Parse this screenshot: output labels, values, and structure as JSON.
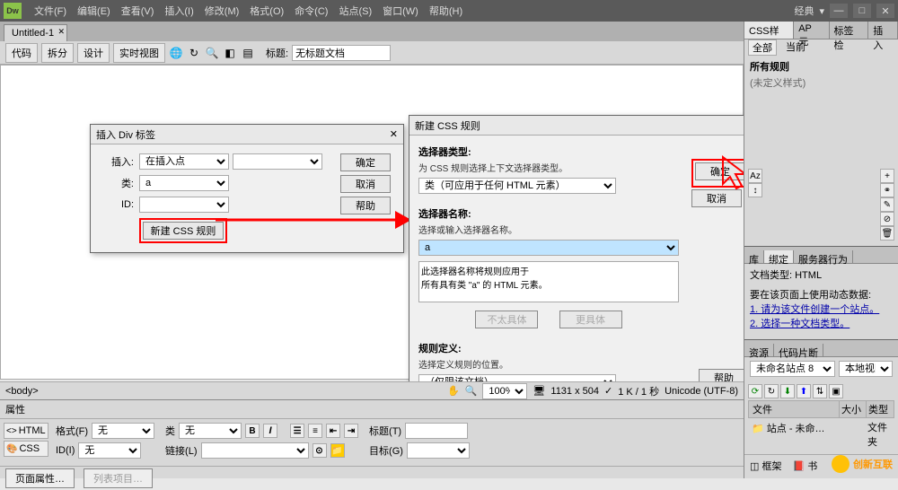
{
  "menubar": {
    "items": [
      "文件(F)",
      "编辑(E)",
      "查看(V)",
      "插入(I)",
      "修改(M)",
      "格式(O)",
      "命令(C)",
      "站点(S)",
      "窗口(W)",
      "帮助(H)"
    ],
    "layout_label": "经典"
  },
  "document": {
    "tab_label": "Untitled-1"
  },
  "toolbar": {
    "views": [
      "代码",
      "拆分",
      "设计",
      "实时视图"
    ],
    "title_label": "标题:",
    "title_value": "无标题文档"
  },
  "dialog_div": {
    "title": "插入 Div 标签",
    "insert_label": "插入:",
    "insert_value": "在插入点",
    "class_label": "类:",
    "class_value": "a",
    "id_label": "ID:",
    "id_value": "",
    "new_rule_btn": "新建 CSS 规则",
    "ok": "确定",
    "cancel": "取消",
    "help": "帮助"
  },
  "dialog_css": {
    "title": "新建 CSS 规则",
    "selector_type_label": "选择器类型:",
    "selector_type_desc": "为 CSS 规则选择上下文选择器类型。",
    "selector_type_value": "类（可应用于任何 HTML 元素）",
    "selector_name_label": "选择器名称:",
    "selector_name_desc": "选择或输入选择器名称。",
    "selector_name_value": "a",
    "preview_text": "此选择器名称将规则应用于\n所有具有类 \"a\" 的 HTML 元素。",
    "less_specific": "不太具体",
    "more_specific": "更具体",
    "rule_def_label": "规则定义:",
    "rule_def_desc": "选择定义规则的位置。",
    "rule_def_value": "（仅限该文档）",
    "ok": "确定",
    "cancel": "取消",
    "help": "帮助"
  },
  "right_panel": {
    "tabs": [
      "CSS样式",
      "AP 元",
      "标签检",
      "插入"
    ],
    "subtabs": [
      "全部",
      "当前"
    ],
    "all_rules_title": "所有规则",
    "no_style": "(未定义样式)",
    "mid_tabs": [
      "库",
      "绑定",
      "服务器行为"
    ],
    "doc_type_label": "文档类型: HTML",
    "dynamic_hint": "要在该页面上使用动态数据:",
    "step1": "1. 请为该文件创建一个站点。",
    "step2": "2. 选择一种文档类型。",
    "res_tabs": [
      "资源",
      "代码片断"
    ],
    "site_dropdown": "未命名站点 8",
    "view_dropdown": "本地视图",
    "file_header": "文件",
    "size_header": "大小",
    "type_header": "类型",
    "site_row": "站点 - 未命…",
    "folder": "文件夹",
    "frame_label": "框架",
    "book_label": "书"
  },
  "status": {
    "tag": "<body>",
    "zoom": "100%",
    "dims": "1131 x 504",
    "size": "1 K / 1 秒",
    "encoding": "Unicode (UTF-8)"
  },
  "properties": {
    "title": "属性",
    "html_btn": "HTML",
    "css_btn": "CSS",
    "format_label": "格式(F)",
    "format_value": "无",
    "id_label": "ID(I)",
    "id_value": "无",
    "class_label": "类",
    "class_value": "无",
    "link_label": "链接(L)",
    "link_value": "",
    "title_label": "标题(T)",
    "target_label": "目标(G)",
    "page_props": "页面属性…",
    "list_item": "列表项目…"
  },
  "watermark": "创新互联"
}
